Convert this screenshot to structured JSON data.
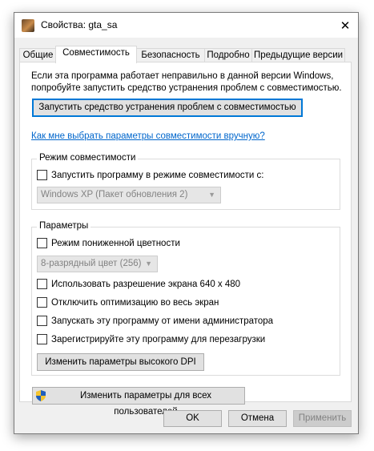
{
  "window": {
    "title": "Свойства: gta_sa"
  },
  "tabs": [
    {
      "label": "Общие"
    },
    {
      "label": "Совместимость"
    },
    {
      "label": "Безопасность"
    },
    {
      "label": "Подробно"
    },
    {
      "label": "Предыдущие версии"
    }
  ],
  "compat": {
    "intro": "Если эта программа работает неправильно в данной версии Windows, попробуйте запустить средство устранения проблем с совместимостью.",
    "troubleshooter_button": "Запустить средство устранения проблем с совместимостью",
    "help_link": "Как мне выбрать параметры совместимости вручную?",
    "mode_group": {
      "title": "Режим совместимости",
      "checkbox": "Запустить программу в режиме совместимости с:",
      "os_select": "Windows XP (Пакет обновления 2)"
    },
    "params_group": {
      "title": "Параметры",
      "reduced_color": "Режим пониженной цветности",
      "color_select": "8-разрядный цвет (256)",
      "res_640": "Использовать разрешение экрана 640 x 480",
      "disable_fullscreen_opt": "Отключить оптимизацию во весь экран",
      "run_as_admin": "Запускать эту программу от имени администратора",
      "register_restart": "Зарегистрируйте эту программу для перезагрузки",
      "dpi_button": "Изменить параметры высокого DPI"
    },
    "all_users_button": "Изменить параметры для всех пользователей"
  },
  "footer": {
    "ok": "OK",
    "cancel": "Отмена",
    "apply": "Применить"
  }
}
